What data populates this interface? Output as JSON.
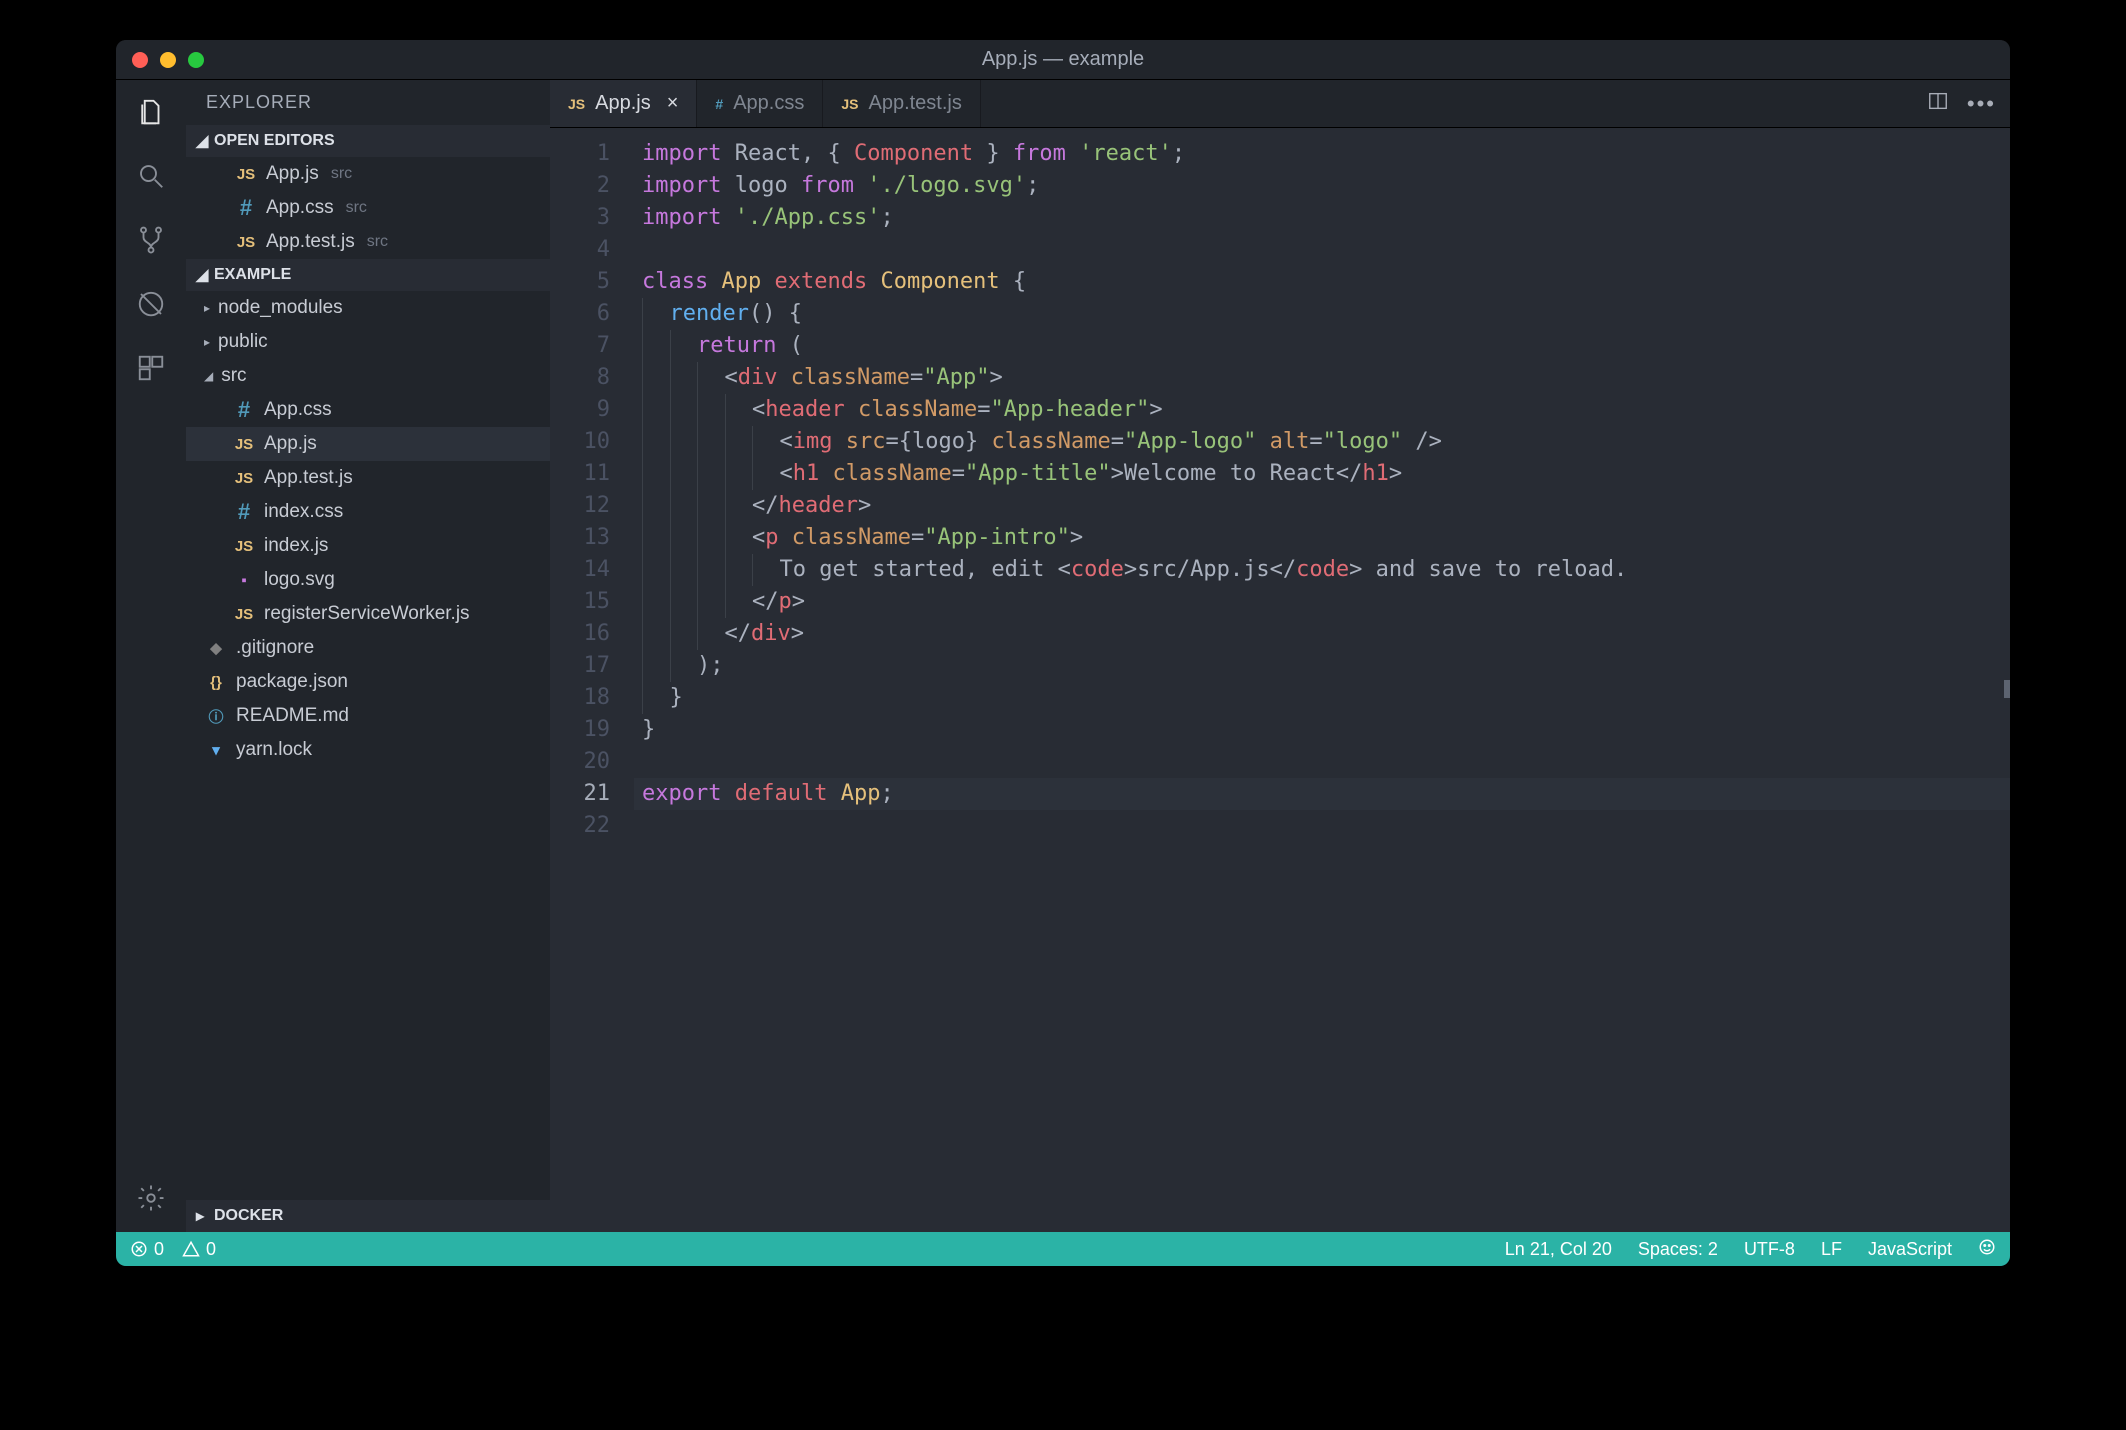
{
  "window_title": "App.js — example",
  "sidebar": {
    "header": "EXPLORER",
    "sections": {
      "open_editors": {
        "label": "OPEN EDITORS",
        "items": [
          {
            "icon": "JS",
            "name": "App.js",
            "detail": "src"
          },
          {
            "icon": "#",
            "name": "App.css",
            "detail": "src"
          },
          {
            "icon": "JS",
            "name": "App.test.js",
            "detail": "src"
          }
        ]
      },
      "example": {
        "label": "EXAMPLE",
        "items": [
          {
            "chev": "▸",
            "name": "node_modules"
          },
          {
            "chev": "▸",
            "name": "public"
          },
          {
            "chev": "◢",
            "name": "src"
          },
          {
            "icon": "#",
            "name": "App.css",
            "indent": true
          },
          {
            "icon": "JS",
            "name": "App.js",
            "indent": true,
            "selected": true
          },
          {
            "icon": "JS",
            "name": "App.test.js",
            "indent": true
          },
          {
            "icon": "#",
            "name": "index.css",
            "indent": true
          },
          {
            "icon": "JS",
            "name": "index.js",
            "indent": true
          },
          {
            "icon": "svg",
            "name": "logo.svg",
            "indent": true
          },
          {
            "icon": "JS",
            "name": "registerServiceWorker.js",
            "indent": true
          },
          {
            "icon": "git",
            "name": ".gitignore"
          },
          {
            "icon": "{}",
            "name": "package.json"
          },
          {
            "icon": "ⓘ",
            "name": "README.md"
          },
          {
            "icon": "yarn",
            "name": "yarn.lock"
          }
        ]
      },
      "docker": {
        "label": "DOCKER"
      }
    }
  },
  "tabs": [
    {
      "icon": "JS",
      "label": "App.js",
      "active": true,
      "closable": true
    },
    {
      "icon": "#",
      "label": "App.css"
    },
    {
      "icon": "JS",
      "label": "App.test.js"
    }
  ],
  "code": [
    {
      "n": 1,
      "seg": [
        [
          "kw-i",
          "import"
        ],
        [
          "white",
          " React"
        ],
        [
          "punc",
          ", { "
        ],
        [
          "ident",
          "Component"
        ],
        [
          "punc",
          " } "
        ],
        [
          "kw-i",
          "from"
        ],
        [
          "white",
          " "
        ],
        [
          "str",
          "'react'"
        ],
        [
          "punc",
          ";"
        ]
      ]
    },
    {
      "n": 2,
      "seg": [
        [
          "kw-i",
          "import"
        ],
        [
          "white",
          " logo "
        ],
        [
          "kw-i",
          "from"
        ],
        [
          "white",
          " "
        ],
        [
          "str",
          "'./logo.svg'"
        ],
        [
          "punc",
          ";"
        ]
      ]
    },
    {
      "n": 3,
      "seg": [
        [
          "kw-i",
          "import"
        ],
        [
          "white",
          " "
        ],
        [
          "str",
          "'./App.css'"
        ],
        [
          "punc",
          ";"
        ]
      ]
    },
    {
      "n": 4,
      "seg": []
    },
    {
      "n": 5,
      "seg": [
        [
          "kw-i",
          "class"
        ],
        [
          "white",
          " "
        ],
        [
          "idy",
          "App"
        ],
        [
          "white",
          " "
        ],
        [
          "ident",
          "extends"
        ],
        [
          "white",
          " "
        ],
        [
          "idy",
          "Component"
        ],
        [
          "white",
          " "
        ],
        [
          "punc",
          "{"
        ]
      ]
    },
    {
      "n": 6,
      "indent": 1,
      "seg": [
        [
          "fn",
          "render"
        ],
        [
          "punc",
          "() {"
        ]
      ]
    },
    {
      "n": 7,
      "indent": 2,
      "seg": [
        [
          "kw-i",
          "return"
        ],
        [
          "punc",
          " ("
        ]
      ]
    },
    {
      "n": 8,
      "indent": 3,
      "seg": [
        [
          "punc",
          "<"
        ],
        [
          "tag",
          "div"
        ],
        [
          "white",
          " "
        ],
        [
          "attr",
          "className"
        ],
        [
          "punc",
          "="
        ],
        [
          "str",
          "\"App\""
        ],
        [
          "punc",
          ">"
        ]
      ]
    },
    {
      "n": 9,
      "indent": 4,
      "seg": [
        [
          "punc",
          "<"
        ],
        [
          "tag",
          "header"
        ],
        [
          "white",
          " "
        ],
        [
          "attr",
          "className"
        ],
        [
          "punc",
          "="
        ],
        [
          "str",
          "\"App-header\""
        ],
        [
          "punc",
          ">"
        ]
      ]
    },
    {
      "n": 10,
      "indent": 5,
      "seg": [
        [
          "punc",
          "<"
        ],
        [
          "tag",
          "img"
        ],
        [
          "white",
          " "
        ],
        [
          "attr",
          "src"
        ],
        [
          "punc",
          "={"
        ],
        [
          "white",
          "logo"
        ],
        [
          "punc",
          "} "
        ],
        [
          "attr",
          "className"
        ],
        [
          "punc",
          "="
        ],
        [
          "str",
          "\"App-logo\""
        ],
        [
          "white",
          " "
        ],
        [
          "attr",
          "alt"
        ],
        [
          "punc",
          "="
        ],
        [
          "str",
          "\"logo\""
        ],
        [
          "punc",
          " />"
        ]
      ]
    },
    {
      "n": 11,
      "indent": 5,
      "seg": [
        [
          "punc",
          "<"
        ],
        [
          "tag",
          "h1"
        ],
        [
          "white",
          " "
        ],
        [
          "attr",
          "className"
        ],
        [
          "punc",
          "="
        ],
        [
          "str",
          "\"App-title\""
        ],
        [
          "punc",
          ">"
        ],
        [
          "white",
          "Welcome to React"
        ],
        [
          "punc",
          "</"
        ],
        [
          "tag",
          "h1"
        ],
        [
          "punc",
          ">"
        ]
      ]
    },
    {
      "n": 12,
      "indent": 4,
      "seg": [
        [
          "punc",
          "</"
        ],
        [
          "tag",
          "header"
        ],
        [
          "punc",
          ">"
        ]
      ]
    },
    {
      "n": 13,
      "indent": 4,
      "seg": [
        [
          "punc",
          "<"
        ],
        [
          "tag",
          "p"
        ],
        [
          "white",
          " "
        ],
        [
          "attr",
          "className"
        ],
        [
          "punc",
          "="
        ],
        [
          "str",
          "\"App-intro\""
        ],
        [
          "punc",
          ">"
        ]
      ]
    },
    {
      "n": 14,
      "indent": 5,
      "seg": [
        [
          "white",
          "To get started, edit "
        ],
        [
          "punc",
          "<"
        ],
        [
          "tag",
          "code"
        ],
        [
          "punc",
          ">"
        ],
        [
          "white",
          "src/App.js"
        ],
        [
          "punc",
          "</"
        ],
        [
          "tag",
          "code"
        ],
        [
          "punc",
          ">"
        ],
        [
          "white",
          " and save to reload."
        ]
      ]
    },
    {
      "n": 15,
      "indent": 4,
      "seg": [
        [
          "punc",
          "</"
        ],
        [
          "tag",
          "p"
        ],
        [
          "punc",
          ">"
        ]
      ]
    },
    {
      "n": 16,
      "indent": 3,
      "seg": [
        [
          "punc",
          "</"
        ],
        [
          "tag",
          "div"
        ],
        [
          "punc",
          ">"
        ]
      ]
    },
    {
      "n": 17,
      "indent": 2,
      "seg": [
        [
          "punc",
          ");"
        ]
      ]
    },
    {
      "n": 18,
      "indent": 1,
      "seg": [
        [
          "punc",
          "}"
        ]
      ]
    },
    {
      "n": 19,
      "seg": [
        [
          "punc",
          "}"
        ]
      ]
    },
    {
      "n": 20,
      "seg": []
    },
    {
      "n": 21,
      "cur": true,
      "seg": [
        [
          "kw-i",
          "export"
        ],
        [
          "white",
          " "
        ],
        [
          "ident",
          "default"
        ],
        [
          "white",
          " "
        ],
        [
          "idy",
          "App"
        ],
        [
          "punc",
          ";"
        ]
      ]
    },
    {
      "n": 22,
      "seg": []
    }
  ],
  "statusbar": {
    "errors": "0",
    "warnings": "0",
    "position": "Ln 21, Col 20",
    "spaces": "Spaces: 2",
    "encoding": "UTF-8",
    "eol": "LF",
    "language": "JavaScript"
  }
}
